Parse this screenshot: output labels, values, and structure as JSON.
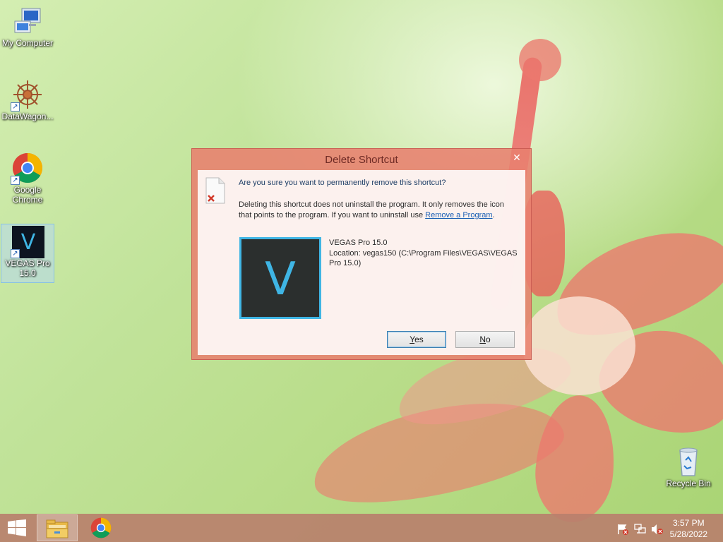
{
  "desktop": {
    "icons": [
      {
        "label": "My Computer"
      },
      {
        "label": "DataWagon..."
      },
      {
        "label": "Google Chrome"
      },
      {
        "label": "VEGAS Pro 15.0"
      },
      {
        "label": "Recycle Bin"
      }
    ]
  },
  "dialog": {
    "title": "Delete Shortcut",
    "close_glyph": "✕",
    "question": "Are you sure you want to permanently remove this shortcut?",
    "info": "Deleting this shortcut does not uninstall the program. It only removes the icon that points to the program. If you want to uninstall use ",
    "link": "Remove a Program",
    "info_tail": ".",
    "app_icon_letter": "V",
    "app_name": "VEGAS Pro 15.0",
    "app_location": "Location: vegas150 (C:\\Program Files\\VEGAS\\VEGAS Pro 15.0)",
    "yes_underlined": "Y",
    "yes_rest": "es",
    "no_underlined": "N",
    "no_rest": "o"
  },
  "taskbar": {
    "time": "3:57 PM",
    "date": "5/28/2022"
  },
  "colors": {
    "accent_vegas": "#3fb5e4",
    "taskbar": "#b8806c",
    "dialog_frame": "#e8806e"
  }
}
